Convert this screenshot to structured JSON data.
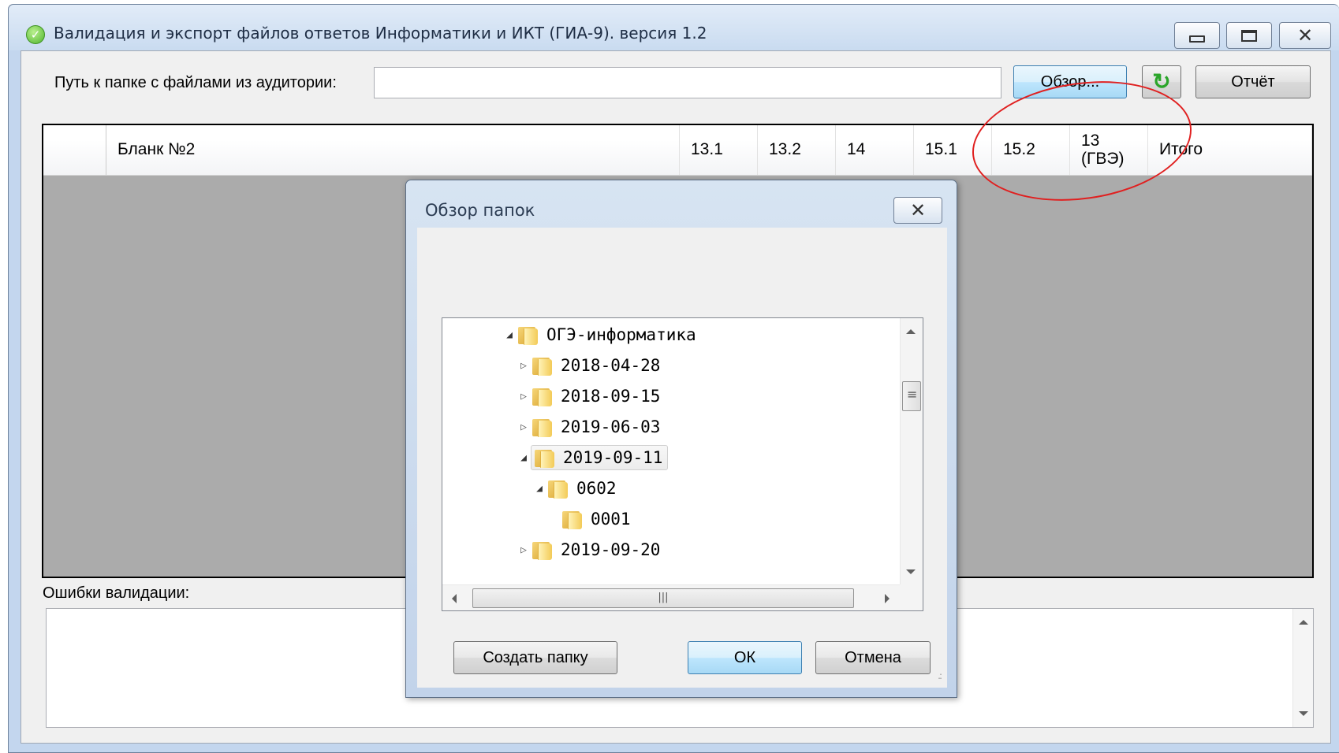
{
  "window": {
    "title": "Валидация и экспорт файлов ответов Информатики и ИКТ (ГИА-9). версия 1.2"
  },
  "toolbar": {
    "path_label": "Путь к папке с файлами из аудитории:",
    "path_value": "",
    "browse_label": "Обзор...",
    "refresh_icon": "refresh-icon",
    "report_label": "Отчёт"
  },
  "grid": {
    "columns": [
      "Бланк №2",
      "13.1",
      "13.2",
      "14",
      "15.1",
      "15.2",
      "13 (ГВЭ)",
      "Итого"
    ]
  },
  "errors": {
    "label": "Ошибки валидации:",
    "value": ""
  },
  "dialog": {
    "title": "Обзор папок",
    "tree": [
      {
        "label": "ОГЭ-информатика",
        "level": 0,
        "expanded": true
      },
      {
        "label": "2018-04-28",
        "level": 1,
        "expanded": false
      },
      {
        "label": "2018-09-15",
        "level": 1,
        "expanded": false
      },
      {
        "label": "2019-06-03",
        "level": 1,
        "expanded": false
      },
      {
        "label": "2019-09-11",
        "level": 1,
        "expanded": true,
        "selected": true
      },
      {
        "label": "0602",
        "level": 2,
        "expanded": true
      },
      {
        "label": "0001",
        "level": 3,
        "expanded": null
      },
      {
        "label": "2019-09-20",
        "level": 1,
        "expanded": false
      }
    ],
    "new_folder_label": "Создать папку",
    "ok_label": "ОК",
    "cancel_label": "Отмена"
  },
  "colors": {
    "annotation": "#e02020",
    "grid_background": "#ababab",
    "titlebar": "#c9dbf0"
  }
}
